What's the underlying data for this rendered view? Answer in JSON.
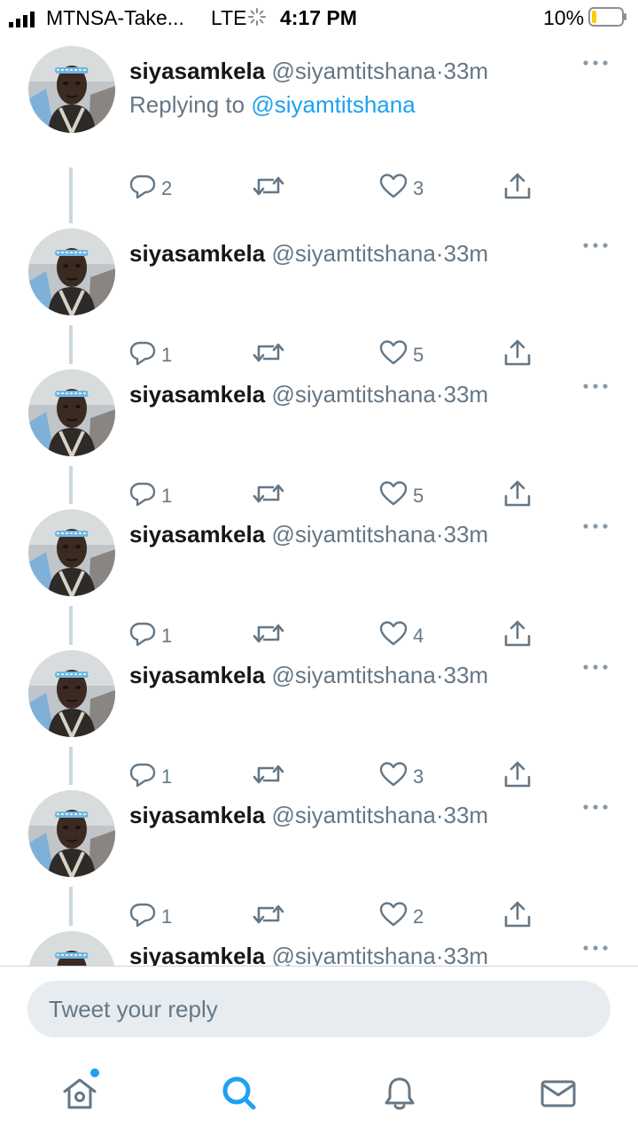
{
  "status_bar": {
    "carrier": "MTNSA-Take...",
    "network": "LTE",
    "time": "4:17 PM",
    "battery_percent": "10%"
  },
  "colors": {
    "accent": "#1da1f2",
    "muted": "#657786",
    "text": "#14171a",
    "thread_line": "#ccd6dd"
  },
  "tweets": [
    {
      "display_name": "siyasamkela",
      "handle": "@siyamtitshana",
      "separator": "·",
      "time": "33m",
      "replying_prefix": "Replying to",
      "replying_to": "@siyamtitshana",
      "replies": "2",
      "retweets": "",
      "likes": "3"
    },
    {
      "display_name": "siyasamkela",
      "handle": "@siyamtitshana",
      "separator": "·",
      "time": "33m",
      "replies": "1",
      "retweets": "",
      "likes": "5"
    },
    {
      "display_name": "siyasamkela",
      "handle": "@siyamtitshana",
      "separator": "·",
      "time": "33m",
      "replies": "1",
      "retweets": "",
      "likes": "5"
    },
    {
      "display_name": "siyasamkela",
      "handle": "@siyamtitshana",
      "separator": "·",
      "time": "33m",
      "replies": "1",
      "retweets": "",
      "likes": "4"
    },
    {
      "display_name": "siyasamkela",
      "handle": "@siyamtitshana",
      "separator": "·",
      "time": "33m",
      "replies": "1",
      "retweets": "",
      "likes": "3"
    },
    {
      "display_name": "siyasamkela",
      "handle": "@siyamtitshana",
      "separator": "·",
      "time": "33m",
      "replies": "1",
      "retweets": "",
      "likes": "2"
    },
    {
      "display_name": "siyasamkela",
      "handle": "@siyamtitshana",
      "separator": "·",
      "time": "33m"
    }
  ],
  "reply_bar": {
    "placeholder": "Tweet your reply"
  },
  "tab_bar": {
    "tabs": [
      {
        "icon": "home-icon",
        "active": false,
        "has_notification": true
      },
      {
        "icon": "search-icon",
        "active": true,
        "has_notification": false
      },
      {
        "icon": "bell-icon",
        "active": false,
        "has_notification": false
      },
      {
        "icon": "mail-icon",
        "active": false,
        "has_notification": false
      }
    ]
  }
}
